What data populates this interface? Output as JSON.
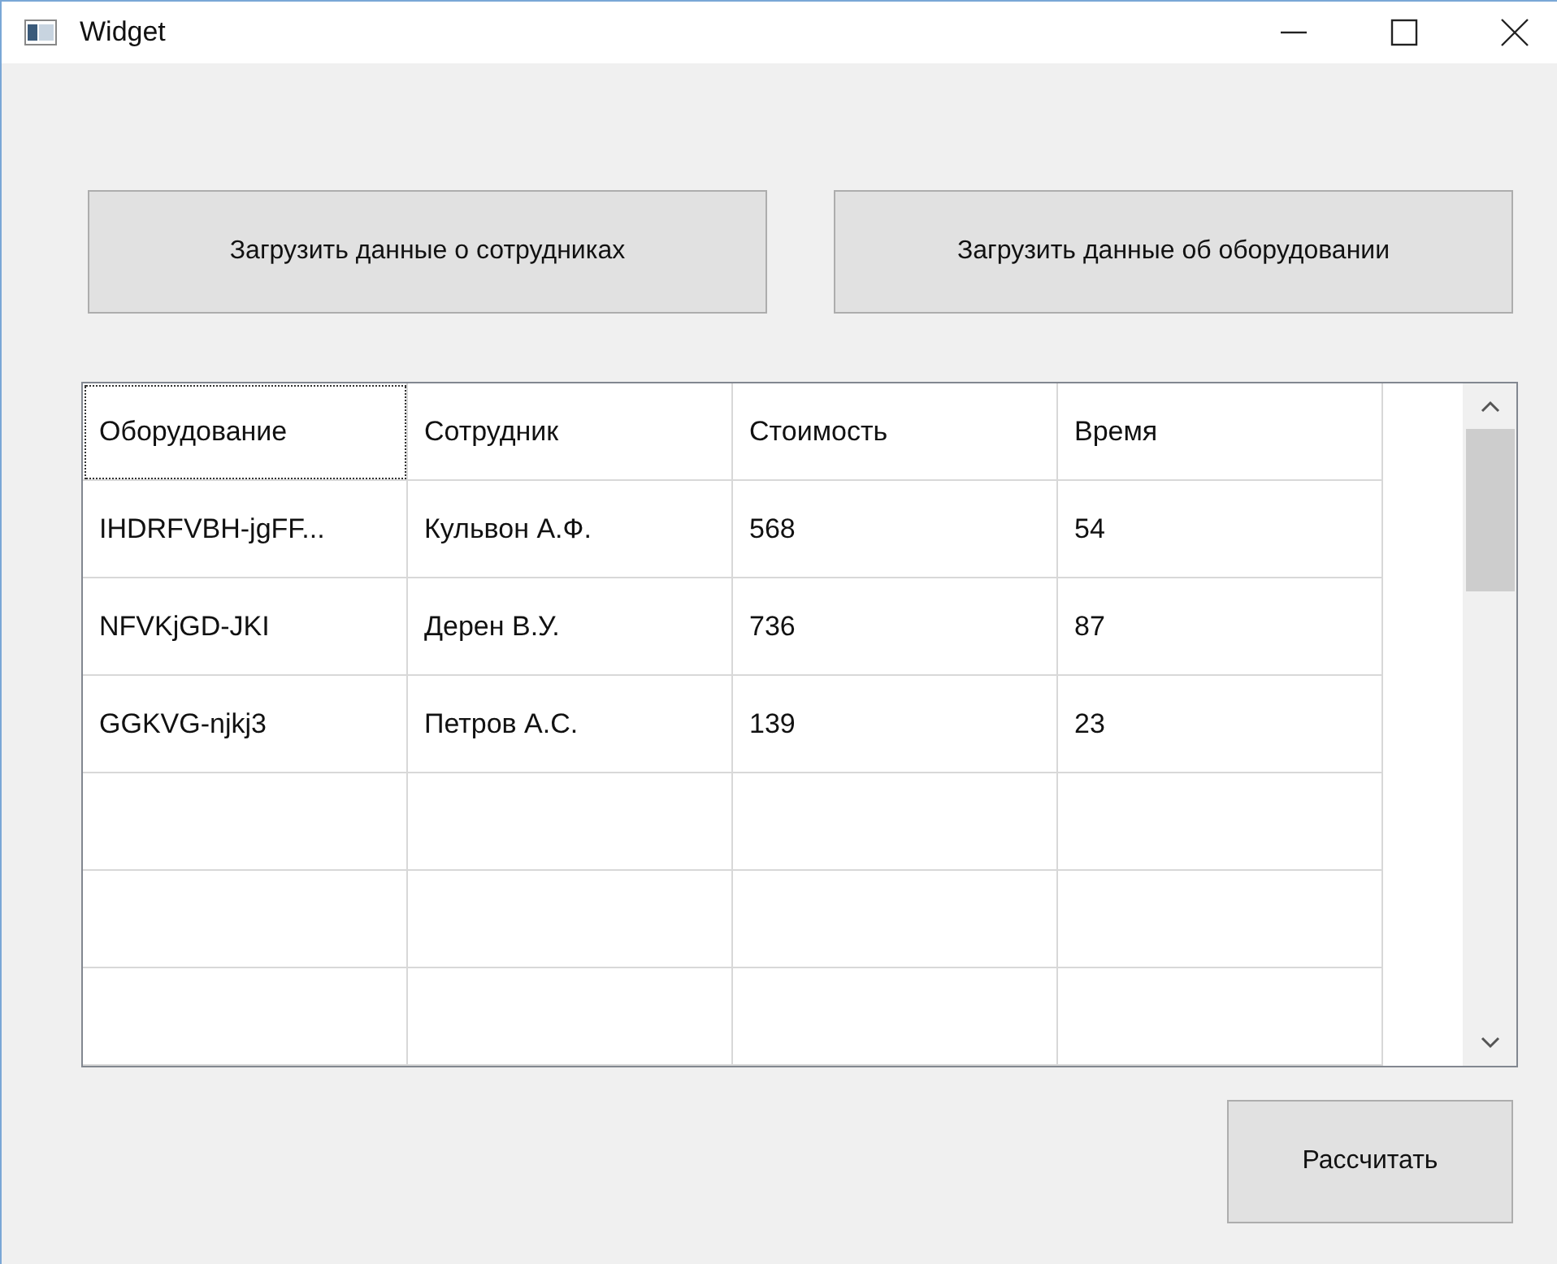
{
  "window": {
    "title": "Widget"
  },
  "buttons": [
    {
      "label": "Загрузить данные о сотрудниках"
    },
    {
      "label": "Загрузить данные об оборудовании"
    }
  ],
  "table": {
    "rows": [
      {
        "cells": [
          {
            "text": "Оборудование",
            "focused": true
          },
          {
            "text": "Сотрудник",
            "focused": false
          },
          {
            "text": "Стоимость",
            "focused": false
          },
          {
            "text": "Время",
            "focused": false
          }
        ]
      },
      {
        "cells": [
          {
            "text": "IHDRFVBH-jgFF...",
            "focused": false
          },
          {
            "text": "Кульвон А.Ф.",
            "focused": false
          },
          {
            "text": "568",
            "focused": false
          },
          {
            "text": "54",
            "focused": false
          }
        ]
      },
      {
        "cells": [
          {
            "text": "NFVKjGD-JKI",
            "focused": false
          },
          {
            "text": "Дерен В.У.",
            "focused": false
          },
          {
            "text": "736",
            "focused": false
          },
          {
            "text": "87",
            "focused": false
          }
        ]
      },
      {
        "cells": [
          {
            "text": "GGKVG-njkj3",
            "focused": false
          },
          {
            "text": "Петров А.С.",
            "focused": false
          },
          {
            "text": "139",
            "focused": false
          },
          {
            "text": "23",
            "focused": false
          }
        ]
      }
    ]
  },
  "calculate_button": {
    "label": "Рассчитать"
  }
}
